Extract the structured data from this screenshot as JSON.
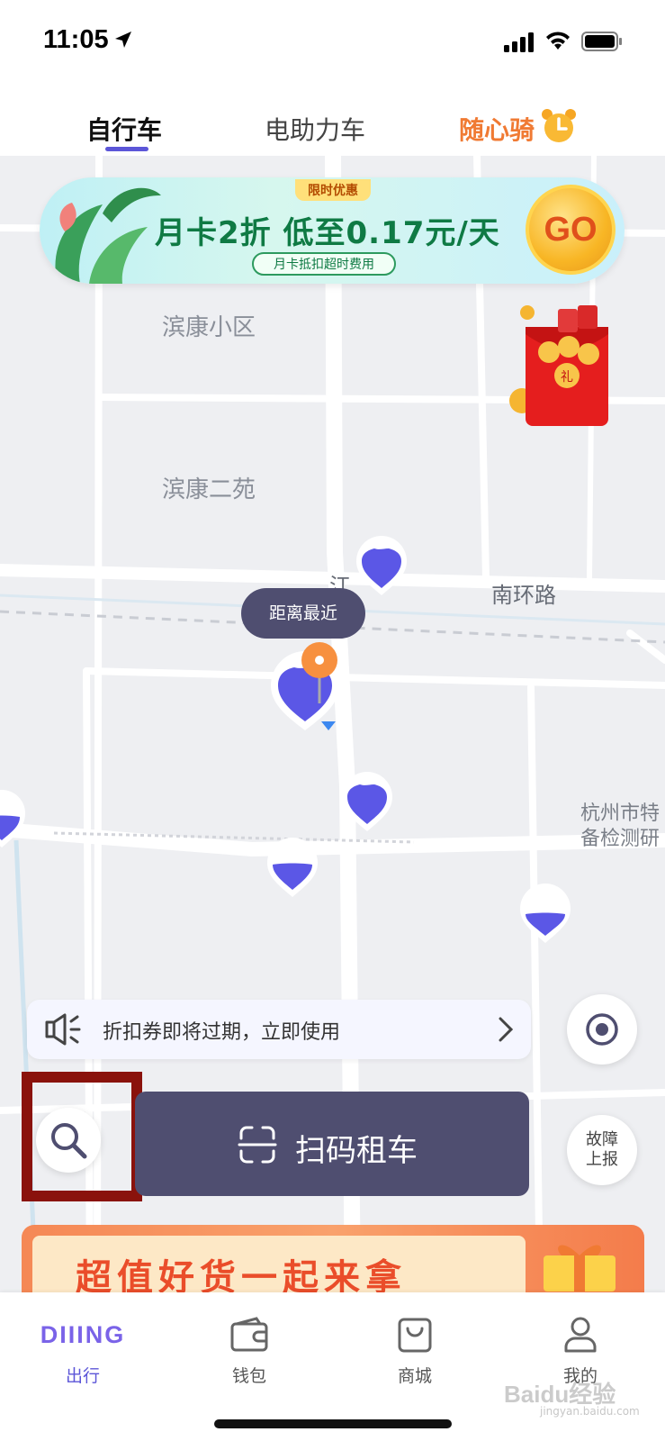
{
  "status_bar": {
    "time": "11:05"
  },
  "tabs": {
    "bike": "自行车",
    "ebike": "电助力车",
    "ride": "随心骑"
  },
  "promo": {
    "tag": "限时优惠",
    "title": "月卡2折  低至0.17元/天",
    "subtitle": "月卡抵扣超时费用",
    "go": "GO"
  },
  "map": {
    "labels": {
      "binkang_xiaoqu": "滨康小区",
      "binkang_eryuan": "滨康二苑",
      "nanhuan_road": "南环路",
      "jiang": "江",
      "hz_line1": "杭州市特",
      "hz_line2": "备检测研"
    },
    "tooltip": "距离最近"
  },
  "redpacket": {
    "label": "礼"
  },
  "notice": {
    "text": "折扣券即将过期，立即使用"
  },
  "scan": {
    "label": "扫码租车"
  },
  "report": {
    "line1": "故障",
    "line2": "上报"
  },
  "goods_banner": {
    "text": "超值好货一起来拿"
  },
  "tabbar": {
    "logo": "DIIING",
    "travel": "出行",
    "wallet": "钱包",
    "mall": "商城",
    "mine": "我的"
  },
  "watermark": {
    "main": "Baidu经验",
    "sub": "jingyan.baidu.com"
  },
  "colors": {
    "accent": "#5c56d8",
    "dark_button": "#4f4e70",
    "orange": "#f07a33",
    "highlight": "#8a120c"
  }
}
